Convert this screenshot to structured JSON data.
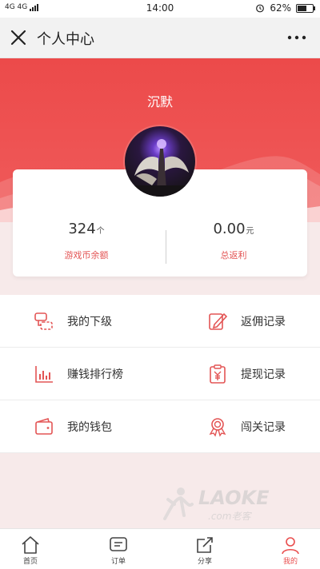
{
  "status_bar": {
    "network": "4G 4G",
    "time": "14:00",
    "battery": "62%",
    "battery_level": 0.62
  },
  "titlebar": {
    "title": "个人中心"
  },
  "profile": {
    "name": "沉默"
  },
  "stats": [
    {
      "value": "324",
      "unit": "个",
      "label": "游戏币余额"
    },
    {
      "value": "0.00",
      "unit": "元",
      "label": "总返利"
    }
  ],
  "menu": [
    {
      "label": "我的下级",
      "icon": "subordinates-icon"
    },
    {
      "label": "返佣记录",
      "icon": "edit-record-icon"
    },
    {
      "label": "赚钱排行榜",
      "icon": "bar-chart-icon"
    },
    {
      "label": "提现记录",
      "icon": "yuan-clipboard-icon"
    },
    {
      "label": "我的钱包",
      "icon": "wallet-icon"
    },
    {
      "label": "闯关记录",
      "icon": "award-icon"
    }
  ],
  "watermark": {
    "text": "LAOKE",
    "sub": ".com老客"
  },
  "tabs": [
    {
      "label": "首页",
      "icon": "home-icon",
      "active": false
    },
    {
      "label": "订单",
      "icon": "order-icon",
      "active": false
    },
    {
      "label": "分享",
      "icon": "share-icon",
      "active": false
    },
    {
      "label": "我的",
      "icon": "user-icon",
      "active": true
    }
  ],
  "colors": {
    "accent": "#e94d4d",
    "hero": "#ee5050",
    "page_bg": "#f7eaea"
  }
}
